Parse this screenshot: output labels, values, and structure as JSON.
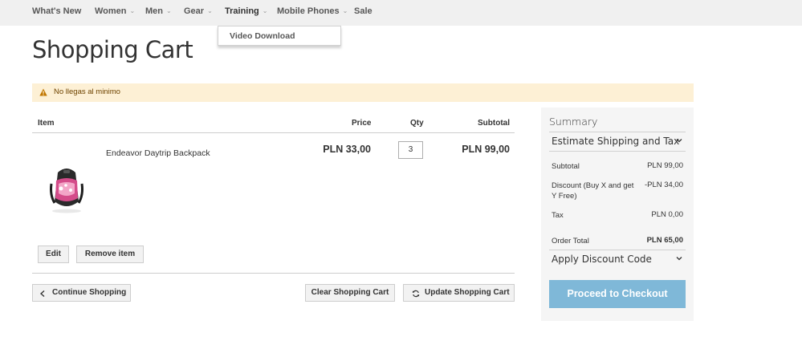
{
  "nav": {
    "items": [
      {
        "label": "What's New"
      },
      {
        "label": "Women",
        "caret": "⌄"
      },
      {
        "label": "Men",
        "caret": "⌄"
      },
      {
        "label": "Gear",
        "caret": "⌄"
      },
      {
        "label": "Training",
        "caret": "⌄"
      },
      {
        "label": "Mobile Phones",
        "caret": "⌄"
      },
      {
        "label": "Sale"
      }
    ],
    "dropdown_item": "Video Download"
  },
  "page_title": "Shopping Cart",
  "warning": {
    "text": "No llegas al minimo",
    "icon": "warning-icon"
  },
  "cart": {
    "headers": {
      "item": "Item",
      "price": "Price",
      "qty": "Qty",
      "subtotal": "Subtotal"
    },
    "row": {
      "name": "Endeavor Daytrip Backpack",
      "price": "PLN 33,00",
      "qty": "3",
      "subtotal": "PLN 99,00",
      "image": "backpack-image"
    },
    "edit_label": "Edit",
    "remove_label": "Remove item",
    "continue_label": "Continue Shopping",
    "clear_label": "Clear Shopping Cart",
    "update_label": "Update Shopping Cart"
  },
  "summary": {
    "title": "Summary",
    "estimate_label": "Estimate Shipping and Tax",
    "subtotal_label": "Subtotal",
    "subtotal_value": "PLN 99,00",
    "discount_label": "Discount (Buy X and get Y Free)",
    "discount_value": "-PLN 34,00",
    "tax_label": "Tax",
    "tax_value": "PLN 0,00",
    "order_total_label": "Order Total",
    "order_total_value": "PLN 65,00",
    "apply_discount_label": "Apply Discount Code",
    "checkout_label": "Proceed to Checkout"
  },
  "colors": {
    "nav_bg": "#f0f0f0",
    "warning_bg": "#fdf0d5",
    "warning_icon": "#c07600",
    "checkout_bg": "#7fb8d8",
    "summary_bg": "#f5f5f5"
  }
}
